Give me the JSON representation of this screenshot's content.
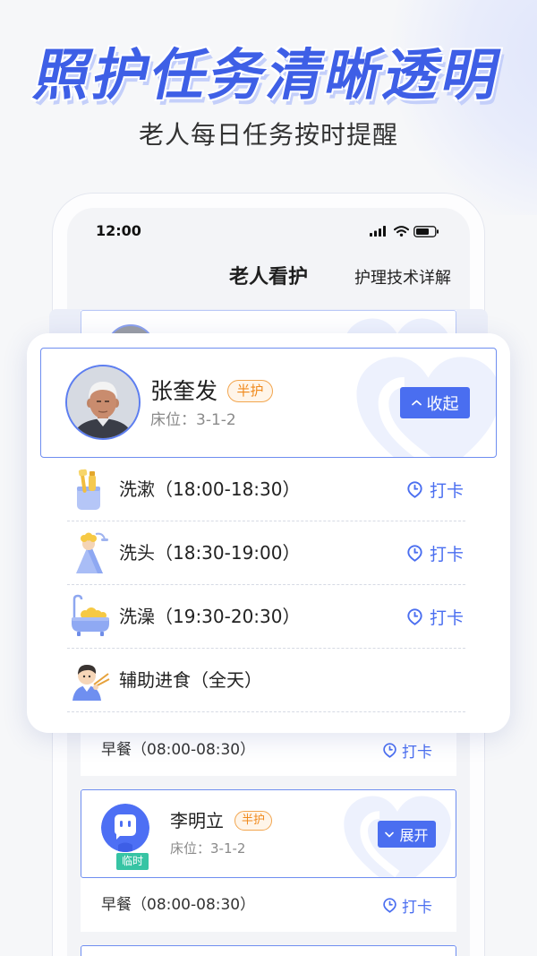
{
  "headline": "照护任务清晰透明",
  "subtitle": "老人每日任务按时提醒",
  "status_bar": {
    "time": "12:00",
    "icons": [
      "signal-icon",
      "wifi-icon",
      "battery-icon"
    ]
  },
  "nav": {
    "title": "老人看护",
    "link": "护理技术详解"
  },
  "expanded_elder": {
    "name": "张奎发",
    "care_level": "半护",
    "bed": "床位：3-1-2",
    "toggle_label": "收起",
    "toggle_icon": "chevron-up-icon",
    "tasks": [
      {
        "icon": "wash-icon",
        "label": "洗漱（18:00-18:30）",
        "action": "打卡"
      },
      {
        "icon": "hair-wash-icon",
        "label": "洗头（18:30-19:00）",
        "action": "打卡"
      },
      {
        "icon": "bath-icon",
        "label": "洗澡（19:30-20:30）",
        "action": "打卡"
      },
      {
        "icon": "feeding-icon",
        "label": "辅助进食（全天）"
      }
    ]
  },
  "cards": [
    {
      "tasks": [
        {
          "label": "早餐（08:00-08:30）",
          "action": "打卡"
        }
      ]
    },
    {
      "name": "李明立",
      "tag": "临时",
      "care_level": "半护",
      "bed": "床位：3-1-2",
      "toggle_label": "展开",
      "toggle_icon": "chevron-down-icon",
      "tasks": [
        {
          "label": "早餐（08:00-08:30）",
          "action": "打卡"
        }
      ]
    }
  ],
  "colors": {
    "accent": "#4a6ef0",
    "headline": "#3e5fe6",
    "badge": "#f0891b",
    "tag": "#37c4a4",
    "card_border": "#6f8ef0"
  }
}
